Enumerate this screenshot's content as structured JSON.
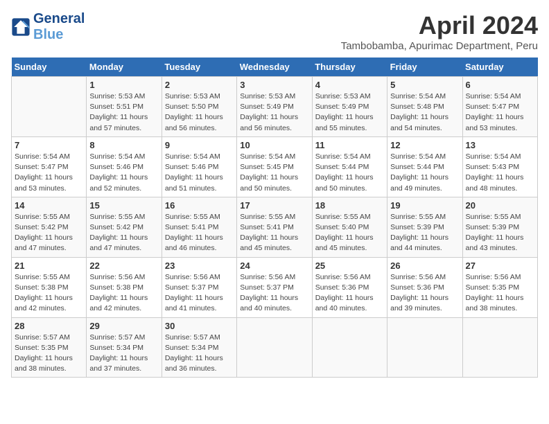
{
  "header": {
    "logo_line1": "General",
    "logo_line2": "Blue",
    "month": "April 2024",
    "location": "Tambobamba, Apurimac Department, Peru"
  },
  "days_of_week": [
    "Sunday",
    "Monday",
    "Tuesday",
    "Wednesday",
    "Thursday",
    "Friday",
    "Saturday"
  ],
  "weeks": [
    [
      {
        "day": "",
        "info": ""
      },
      {
        "day": "1",
        "info": "Sunrise: 5:53 AM\nSunset: 5:51 PM\nDaylight: 11 hours\nand 57 minutes."
      },
      {
        "day": "2",
        "info": "Sunrise: 5:53 AM\nSunset: 5:50 PM\nDaylight: 11 hours\nand 56 minutes."
      },
      {
        "day": "3",
        "info": "Sunrise: 5:53 AM\nSunset: 5:49 PM\nDaylight: 11 hours\nand 56 minutes."
      },
      {
        "day": "4",
        "info": "Sunrise: 5:53 AM\nSunset: 5:49 PM\nDaylight: 11 hours\nand 55 minutes."
      },
      {
        "day": "5",
        "info": "Sunrise: 5:54 AM\nSunset: 5:48 PM\nDaylight: 11 hours\nand 54 minutes."
      },
      {
        "day": "6",
        "info": "Sunrise: 5:54 AM\nSunset: 5:47 PM\nDaylight: 11 hours\nand 53 minutes."
      }
    ],
    [
      {
        "day": "7",
        "info": "Sunrise: 5:54 AM\nSunset: 5:47 PM\nDaylight: 11 hours\nand 53 minutes."
      },
      {
        "day": "8",
        "info": "Sunrise: 5:54 AM\nSunset: 5:46 PM\nDaylight: 11 hours\nand 52 minutes."
      },
      {
        "day": "9",
        "info": "Sunrise: 5:54 AM\nSunset: 5:46 PM\nDaylight: 11 hours\nand 51 minutes."
      },
      {
        "day": "10",
        "info": "Sunrise: 5:54 AM\nSunset: 5:45 PM\nDaylight: 11 hours\nand 50 minutes."
      },
      {
        "day": "11",
        "info": "Sunrise: 5:54 AM\nSunset: 5:44 PM\nDaylight: 11 hours\nand 50 minutes."
      },
      {
        "day": "12",
        "info": "Sunrise: 5:54 AM\nSunset: 5:44 PM\nDaylight: 11 hours\nand 49 minutes."
      },
      {
        "day": "13",
        "info": "Sunrise: 5:54 AM\nSunset: 5:43 PM\nDaylight: 11 hours\nand 48 minutes."
      }
    ],
    [
      {
        "day": "14",
        "info": "Sunrise: 5:55 AM\nSunset: 5:42 PM\nDaylight: 11 hours\nand 47 minutes."
      },
      {
        "day": "15",
        "info": "Sunrise: 5:55 AM\nSunset: 5:42 PM\nDaylight: 11 hours\nand 47 minutes."
      },
      {
        "day": "16",
        "info": "Sunrise: 5:55 AM\nSunset: 5:41 PM\nDaylight: 11 hours\nand 46 minutes."
      },
      {
        "day": "17",
        "info": "Sunrise: 5:55 AM\nSunset: 5:41 PM\nDaylight: 11 hours\nand 45 minutes."
      },
      {
        "day": "18",
        "info": "Sunrise: 5:55 AM\nSunset: 5:40 PM\nDaylight: 11 hours\nand 45 minutes."
      },
      {
        "day": "19",
        "info": "Sunrise: 5:55 AM\nSunset: 5:39 PM\nDaylight: 11 hours\nand 44 minutes."
      },
      {
        "day": "20",
        "info": "Sunrise: 5:55 AM\nSunset: 5:39 PM\nDaylight: 11 hours\nand 43 minutes."
      }
    ],
    [
      {
        "day": "21",
        "info": "Sunrise: 5:55 AM\nSunset: 5:38 PM\nDaylight: 11 hours\nand 42 minutes."
      },
      {
        "day": "22",
        "info": "Sunrise: 5:56 AM\nSunset: 5:38 PM\nDaylight: 11 hours\nand 42 minutes."
      },
      {
        "day": "23",
        "info": "Sunrise: 5:56 AM\nSunset: 5:37 PM\nDaylight: 11 hours\nand 41 minutes."
      },
      {
        "day": "24",
        "info": "Sunrise: 5:56 AM\nSunset: 5:37 PM\nDaylight: 11 hours\nand 40 minutes."
      },
      {
        "day": "25",
        "info": "Sunrise: 5:56 AM\nSunset: 5:36 PM\nDaylight: 11 hours\nand 40 minutes."
      },
      {
        "day": "26",
        "info": "Sunrise: 5:56 AM\nSunset: 5:36 PM\nDaylight: 11 hours\nand 39 minutes."
      },
      {
        "day": "27",
        "info": "Sunrise: 5:56 AM\nSunset: 5:35 PM\nDaylight: 11 hours\nand 38 minutes."
      }
    ],
    [
      {
        "day": "28",
        "info": "Sunrise: 5:57 AM\nSunset: 5:35 PM\nDaylight: 11 hours\nand 38 minutes."
      },
      {
        "day": "29",
        "info": "Sunrise: 5:57 AM\nSunset: 5:34 PM\nDaylight: 11 hours\nand 37 minutes."
      },
      {
        "day": "30",
        "info": "Sunrise: 5:57 AM\nSunset: 5:34 PM\nDaylight: 11 hours\nand 36 minutes."
      },
      {
        "day": "",
        "info": ""
      },
      {
        "day": "",
        "info": ""
      },
      {
        "day": "",
        "info": ""
      },
      {
        "day": "",
        "info": ""
      }
    ]
  ]
}
